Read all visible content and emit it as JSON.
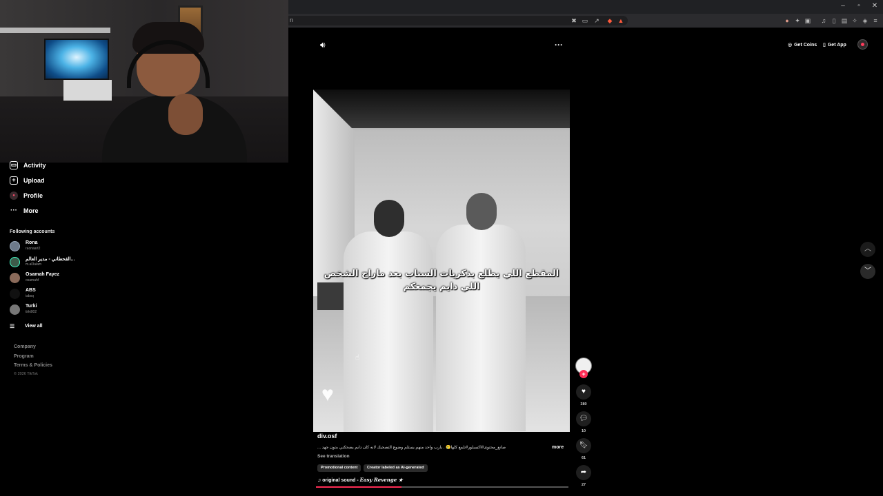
{
  "browser": {
    "url_fragment": "n",
    "window_controls": [
      "–",
      "▫",
      "✕"
    ]
  },
  "sidebar": {
    "nav": [
      {
        "label": "Activity",
        "icon": "activity-icon"
      },
      {
        "label": "Upload",
        "icon": "upload-icon"
      },
      {
        "label": "Profile",
        "icon": "profile-icon"
      },
      {
        "label": "More",
        "icon": "more-icon"
      }
    ],
    "following_title": "Following accounts",
    "accounts": [
      {
        "name": "Rona",
        "handle": "raonaart2"
      },
      {
        "name": "القحطاني - مدير العالم...",
        "handle": "m.al3alam"
      },
      {
        "name": "Osamah Fayez",
        "handle": "osamahf"
      },
      {
        "name": "ABS",
        "handle": "iabsq"
      },
      {
        "name": "Turki",
        "handle": "tirki002"
      }
    ],
    "view_all": "View all",
    "footer": [
      "Company",
      "Program",
      "Terms & Policies"
    ],
    "copyright": "© 2026 TikTok"
  },
  "topbar": {
    "get_coins": "Get Coins",
    "get_app": "Get App"
  },
  "video": {
    "caption": "المقطع اللي يطلع بذكريات السناب بعد ماراح الشخص اللي دايم يجمعكم",
    "author": "div.osf",
    "description": "صانع_محتوى#اكسبلور#تلمع كلها🥲 . يارب واحد منهم يستلم وضوع التصحيك لانه كان دايم يضحكني بدون جهد ...",
    "more": "more",
    "see_translation": "See translation",
    "tags": [
      "Promotional content",
      "Creator labeled as AI-generated"
    ],
    "sound_prefix": "original sound - ",
    "sound_name": "Easy Revenge ★",
    "progress": 0.34
  },
  "actions": {
    "likes": "380",
    "comments": "10",
    "saves": "61",
    "shares": "27"
  },
  "colors": {
    "accent": "#fe2c55"
  }
}
